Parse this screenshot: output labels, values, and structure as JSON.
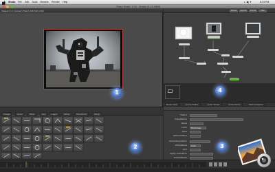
{
  "menubar": {
    "app_name": "Shake",
    "items": [
      "File",
      "Edit",
      "Tools",
      "Viewers",
      "Render",
      "Help"
    ],
    "clock": "8:23 PM"
  },
  "window": {
    "title": "- Proxy Scale: 1.00 - Shake v4.10.0606"
  },
  "viewer": {
    "info_text": "Viewer1 1:1 (Linear) FileIn1.fs8 320×240"
  },
  "node_toolbar": {
    "buttons": [
      "Nodes",
      "Layout",
      "Cache",
      "Filter"
    ]
  },
  "node_tabs": [
    "Node View",
    "Curve Editor",
    "Color Picker",
    "Audio Panel",
    "Pixel Analyzer"
  ],
  "params": {
    "rows": [
      {
        "label": "FileIn1",
        "value": ""
      },
      {
        "label": "imageName",
        "value": ""
      },
      {
        "label": "Mode",
        "value": ""
      },
      {
        "label": "Color",
        "value": "FileImage"
      },
      {
        "label": "Xpos",
        "value": ""
      },
      {
        "label": "optionalValue",
        "value": ""
      },
      {
        "label": "timeInterpolation",
        "value": ""
      },
      {
        "label": "VDataMode",
        "value": "Auto"
      },
      {
        "label": "Link",
        "value": ""
      },
      {
        "label": "Apply Animation",
        "value": ""
      },
      {
        "label": "autoDefaults",
        "value": ""
      },
      {
        "label": "Inputs",
        "value": ""
      }
    ]
  },
  "tool_tabs": [
    "Image",
    "Color",
    "Filter",
    "Key",
    "Layer",
    "Other",
    "Transform",
    "Warp"
  ],
  "badges": [
    "1",
    "2",
    "3",
    "4"
  ],
  "colors": {
    "badge_glow": "#6f96e6",
    "viewer_border": "#b04848",
    "node_selected": "#66b544"
  },
  "icons": {
    "apple": "apple-icon",
    "photo": "iphoto-icon"
  }
}
